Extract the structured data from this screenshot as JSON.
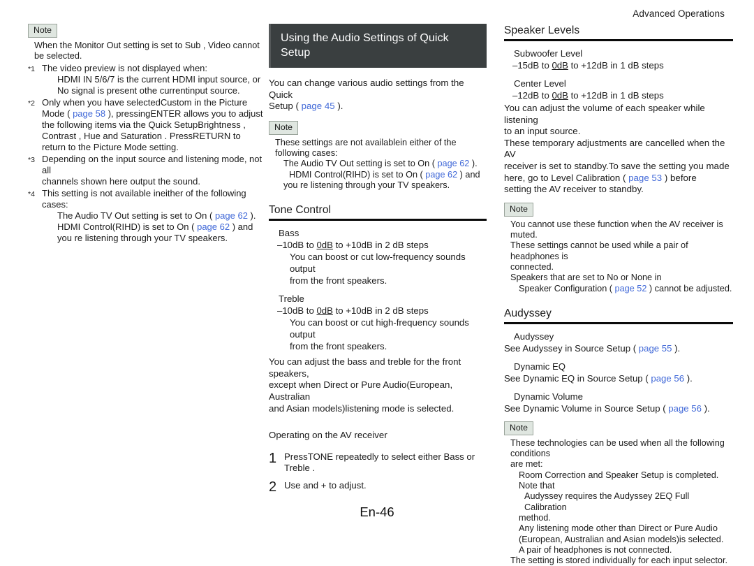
{
  "running_head": "Advanced Operations",
  "folio": "En-46",
  "left_column": {
    "note_badge": "Note",
    "note_line1": "When the Monitor Out setting is set to Sub , Video cannot",
    "note_line2": "be selected.",
    "footnotes": [
      {
        "mark": "*1",
        "line1": "The video preview is not displayed when:",
        "line2": "HDMI IN 5/6/7 is the current HDMI input source, or",
        "line3": "No signal is present othe currentinput source."
      },
      {
        "mark": "*2",
        "line1": "Only when you have selectedCustom in the Picture",
        "line2_a": "Mode ( ",
        "line2_link": "page 58",
        "line2_b": " ), pressingENTER allows you to adjust",
        "line3": "the following items via the Quick SetupBrightness ,",
        "line4": "Contrast , Hue and Saturation . PressRETURN to",
        "line5": "return to the Picture Mode setting."
      },
      {
        "mark": "*3",
        "line1": "Depending on the input source and listening mode, not all",
        "line2": "channels shown here output the sound."
      },
      {
        "mark": "*4",
        "line1": "This setting is not available ineither of the following cases:",
        "line2_a": "The Audio TV Out setting is set to On ( ",
        "line2_link": "page 62",
        "line2_b": " ).",
        "line3_a": "HDMI Control(RIHD) is set to On ( ",
        "line3_link": "page 62",
        "line3_b": " ) and",
        "line4": "you re listening through your TV speakers."
      }
    ]
  },
  "mid_column": {
    "header_line1": "Using the Audio Settings of Quick",
    "header_line2": "Setup",
    "intro_line1": "You can change various audio settings from the Quick",
    "intro_line2_a": "Setup ( ",
    "intro_line2_link": "page 45",
    "intro_line2_b": " ).",
    "note_badge": "Note",
    "note_line1": "These settings are not availablein either of the following cases:",
    "note_line2_a": "The Audio TV Out setting is set to On ( ",
    "note_line2_link": "page 62",
    "note_line2_b": " ).",
    "note_line3_a": "HDMI Control(RIHD) is set to On ( ",
    "note_line3_link": "page 62",
    "note_line3_b": " ) and",
    "note_line4": "you re listening through your TV speakers.",
    "section_title": "Tone Control",
    "bass": {
      "title": "Bass",
      "range_pre": "10dB to ",
      "range_zero": "0dB",
      "range_post": " to +10dB in 2 dB steps",
      "desc_line1": "You can boost or cut low-frequency sounds output",
      "desc_line2": "from the front speakers."
    },
    "treble": {
      "title": "Treble",
      "range_pre": "10dB to ",
      "range_zero": "0dB",
      "range_post": " to +10dB in 2 dB steps",
      "desc_line1": "You can boost or cut high-frequency sounds output",
      "desc_line2": "from the front speakers."
    },
    "para_line1": "You can adjust the bass and treble for the front speakers,",
    "para_line2": "except when Direct or Pure Audio(European, Australian",
    "para_line3": "and Asian models)listening mode is selected.",
    "operating_title": "Operating on the AV receiver",
    "steps": [
      {
        "num": "1",
        "line1": "PressTONE repeatedly to select either Bass or",
        "line2": "Treble ."
      },
      {
        "num": "2",
        "line1": "Use and + to adjust.",
        "line2": ""
      }
    ]
  },
  "right_column": {
    "speaker_levels": {
      "section_title": "Speaker Levels",
      "subwoofer": {
        "title": "Subwoofer Level",
        "range_pre": "15dB to ",
        "range_zero": "0dB",
        "range_post": " to +12dB in 1 dB steps"
      },
      "center": {
        "title": "Center Level",
        "range_pre": "12dB to ",
        "range_zero": "0dB",
        "range_post": " to +12dB in 1 dB steps"
      },
      "para1_line1": "You can adjust the volume of each speaker while listening",
      "para1_line2": "to an input source.",
      "para2_line1": "These temporary adjustments are cancelled when the AV",
      "para2_line2": "receiver is set to standby.To save the setting you made",
      "para2_line3_a": "here, go to Level Calibration ( ",
      "para2_line3_link": "page 53",
      "para2_line3_b": " ) before",
      "para2_line4": "setting the AV receiver to standby.",
      "note_badge": "Note",
      "note_line1": "You cannot use these function when the AV receiver is muted.",
      "note_line2": "These settings cannot be used while a pair of headphones is",
      "note_line3": "connected.",
      "note_line4": "Speakers that are set to No or None in",
      "note_line5_a": "Speaker Configuration ( ",
      "note_line5_link": "page 52",
      "note_line5_b": " ) cannot be adjusted."
    },
    "audyssey": {
      "section_title": "Audyssey",
      "items": [
        {
          "title": "Audyssey",
          "see_pre": "See Audyssey in Source Setup ( ",
          "see_link": "page 55",
          "see_post": " )."
        },
        {
          "title": "Dynamic EQ",
          "see_pre": "See Dynamic EQ in Source Setup ( ",
          "see_link": "page 56",
          "see_post": " )."
        },
        {
          "title": "Dynamic Volume",
          "see_pre": "See Dynamic Volume in Source Setup ( ",
          "see_link": "page 56",
          "see_post": " )."
        }
      ],
      "note_badge": "Note",
      "note_line1": "These technologies can be used when all the following conditions",
      "note_line2": "are met:",
      "note_line3": "Room Correction and Speaker Setup is completed. Note that",
      "note_line4": "Audyssey requires the Audyssey 2EQ Full Calibration",
      "note_line5": "method.",
      "note_line6": "Any listening mode other than Direct or Pure Audio",
      "note_line7": "(European, Australian and Asian models)is selected.",
      "note_line8": "A pair of headphones is not connected.",
      "note_line9": "The setting is stored individually for each input selector."
    }
  }
}
